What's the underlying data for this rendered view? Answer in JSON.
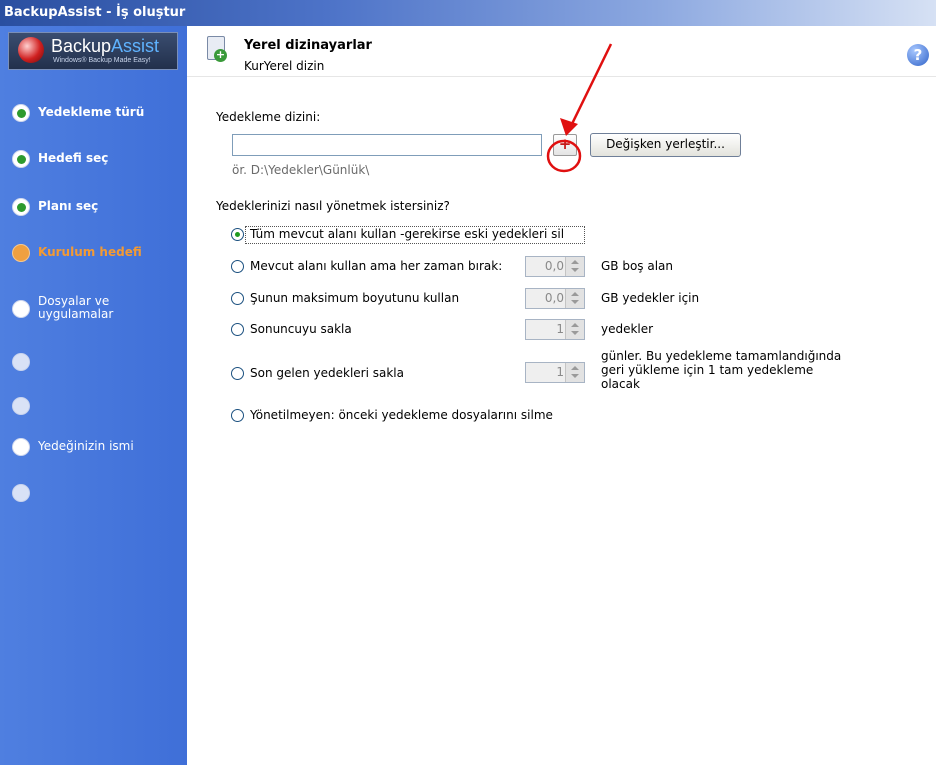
{
  "window": {
    "title": "BackupAssist - İş oluştur"
  },
  "logo": {
    "brand_a": "Backup",
    "brand_b": "Assist",
    "tagline": "Windows® Backup Made Easy!"
  },
  "steps": [
    {
      "label": "Yedekleme türü",
      "state": "done"
    },
    {
      "label": "Hedefi seç",
      "state": "done"
    },
    {
      "label": "Planı seç",
      "state": "done"
    },
    {
      "label": "Kurulum hedefi",
      "state": "current"
    },
    {
      "label": "Dosyalar ve uygulamalar",
      "state": "todo"
    },
    {
      "label": "",
      "state": "disabled"
    },
    {
      "label": "",
      "state": "disabled"
    },
    {
      "label": "Yedeğinizin ismi",
      "state": "todo"
    },
    {
      "label": "",
      "state": "disabled"
    }
  ],
  "header": {
    "title": "Yerel dizinayarlar",
    "subtitle": "KurYerel dizin",
    "help_icon": "help-icon"
  },
  "form": {
    "dir_label": "Yedekleme dizini:",
    "dir_value": "",
    "add_button": "+",
    "variable_button": "Değişken yerleştir...",
    "example": "ör. D:\\Yedekler\\Günlük\\",
    "question": "Yedeklerinizi nasıl yönetmek istersiniz?",
    "options": [
      {
        "label": "Tüm mevcut alanı kullan -gerekirse eski yedekleri sil",
        "selected": true,
        "spin": null,
        "units": ""
      },
      {
        "label": "Mevcut alanı kullan ama her zaman bırak:",
        "selected": false,
        "spin": "0,0",
        "units": "GB boş alan"
      },
      {
        "label": "Şunun maksimum boyutunu kullan",
        "selected": false,
        "spin": "0,0",
        "units": "GB yedekler için"
      },
      {
        "label": "Sonuncuyu sakla",
        "selected": false,
        "spin": "1",
        "units": "yedekler"
      },
      {
        "label": "Son gelen yedekleri sakla",
        "selected": false,
        "spin": "1",
        "units": "günler. Bu yedekleme tamamlandığında geri yükleme için 1 tam yedekleme olacak"
      },
      {
        "label": "Yönetilmeyen: önceki yedekleme dosyalarını silme",
        "selected": false,
        "spin": null,
        "units": ""
      }
    ]
  },
  "annotation": {
    "color": "#e01010"
  }
}
